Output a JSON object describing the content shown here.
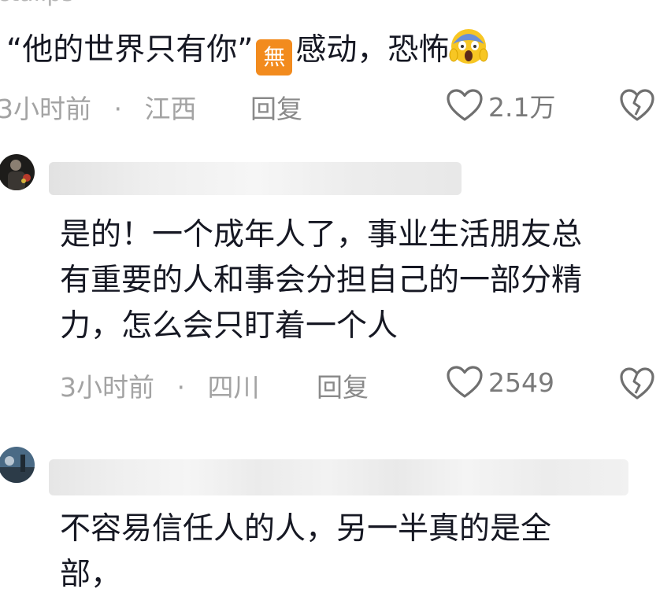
{
  "comments": [
    {
      "username": "ctalips",
      "text_quote": "“他的世界只有你”",
      "text_flag": "無",
      "text_after": "感动，恐怖",
      "emoji": "scream-face-icon",
      "time": "3小时前",
      "location": "江西",
      "reply_label": "回复",
      "likes": "2.1万"
    },
    {
      "lines": [
        "是的！一个成年人了，事业生活朋友总",
        "有重要的人和事会分担自己的一部分精",
        "力，怎么会只盯着一个人"
      ],
      "time": "3小时前",
      "location": "四川",
      "reply_label": "回复",
      "likes": "2549"
    },
    {
      "lines": [
        "不容易信任人的人，另一半真的是全",
        "部，"
      ]
    }
  ],
  "separator": "·",
  "colors": {
    "text": "#161823",
    "meta": "#a3a3a3",
    "icon": "#6f6f6f",
    "flag": "#f28b1e"
  }
}
